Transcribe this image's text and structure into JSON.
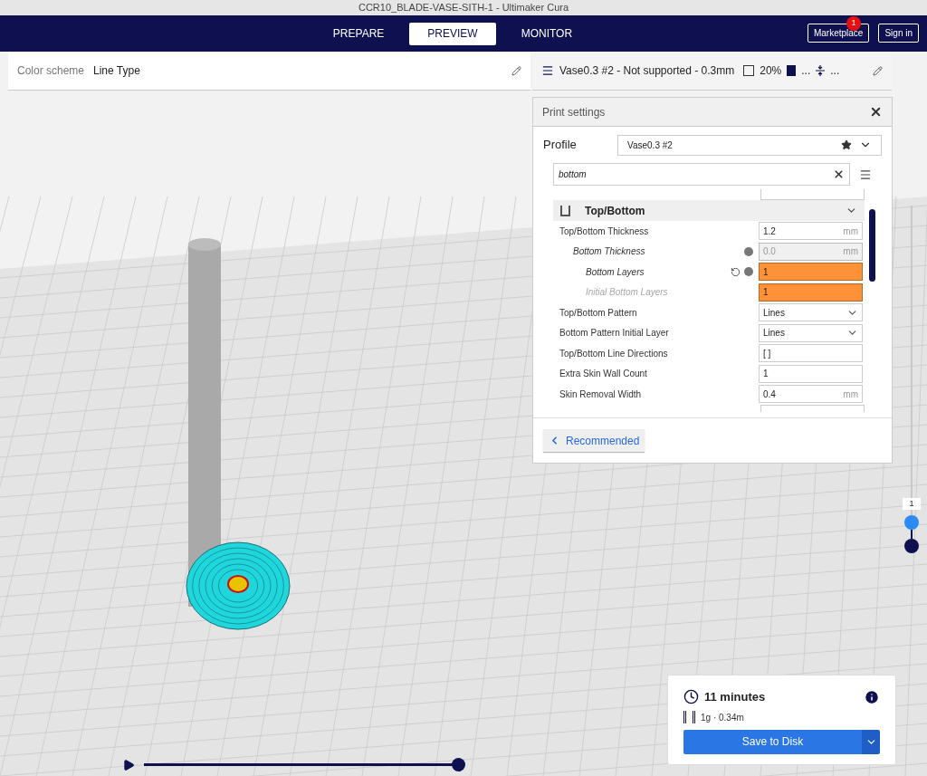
{
  "window": {
    "title": "CCR10_BLADE-VASE-SITH-1 - Ultimaker Cura"
  },
  "stages": [
    {
      "label": "PREPARE",
      "selected": false
    },
    {
      "label": "PREVIEW",
      "selected": true
    },
    {
      "label": "MONITOR",
      "selected": false
    }
  ],
  "account": {
    "marketplace": "Marketplace",
    "badge": "1",
    "sign_in": "Sign in"
  },
  "view_panel": {
    "label": "Color scheme",
    "value": "Line Type"
  },
  "print_setup": {
    "profile": "Vase0.3 #2 - Not supported - 0.3mm",
    "infill": "20%",
    "support": "...",
    "adhesion": "..."
  },
  "print_settings": {
    "title": "Print settings",
    "profile_label": "Profile",
    "profile_value": "Vase0.3 #2",
    "search": {
      "value": "bottom"
    },
    "category": {
      "label": "Top/Bottom",
      "expanded": true
    },
    "settings": [
      {
        "label": "Top/Bottom Thickness",
        "kind": "number",
        "value": "1.2",
        "unit": "mm",
        "disabled": false,
        "readonly": false,
        "error": false,
        "resettable": false,
        "inherited": false,
        "children": [
          {
            "label": "Bottom Thickness",
            "kind": "number",
            "value": "0.0",
            "unit": "mm",
            "disabled": false,
            "readonly": true,
            "error": false,
            "resettable": false,
            "inherited": true,
            "children": [
              {
                "label": "Bottom Layers",
                "kind": "number",
                "value": "1",
                "disabled": false,
                "readonly": false,
                "error": true,
                "resettable": true,
                "inherited": true
              },
              {
                "label": "Initial Bottom Layers",
                "kind": "number",
                "value": "1",
                "disabled": true,
                "readonly": false,
                "error": true,
                "resettable": false,
                "inherited": false
              }
            ]
          }
        ]
      },
      {
        "label": "Top/Bottom Pattern",
        "kind": "dropdown",
        "value": "Lines",
        "disabled": false,
        "readonly": false,
        "error": false,
        "resettable": false,
        "inherited": false
      },
      {
        "label": "Bottom Pattern Initial Layer",
        "kind": "dropdown",
        "value": "Lines",
        "disabled": false,
        "readonly": false,
        "error": false,
        "resettable": false,
        "inherited": false
      },
      {
        "label": "Top/Bottom Line Directions",
        "kind": "number",
        "value": "[ ]",
        "disabled": false,
        "readonly": false,
        "error": false,
        "resettable": false,
        "inherited": false
      },
      {
        "label": "Extra Skin Wall Count",
        "kind": "number",
        "value": "1",
        "disabled": false,
        "readonly": false,
        "error": false,
        "resettable": false,
        "inherited": false
      },
      {
        "label": "Skin Removal Width",
        "kind": "number",
        "value": "0.4",
        "unit": "mm",
        "disabled": false,
        "readonly": false,
        "error": false,
        "resettable": false,
        "inherited": false
      }
    ],
    "recommended_button": "Recommended"
  },
  "layer_slider": {
    "value": "1",
    "level": 0.07
  },
  "playback": {
    "level": 1
  },
  "print_info": {
    "time": "11 minutes",
    "material": "1g · 0.34m",
    "save_button": "Save to Disk"
  }
}
